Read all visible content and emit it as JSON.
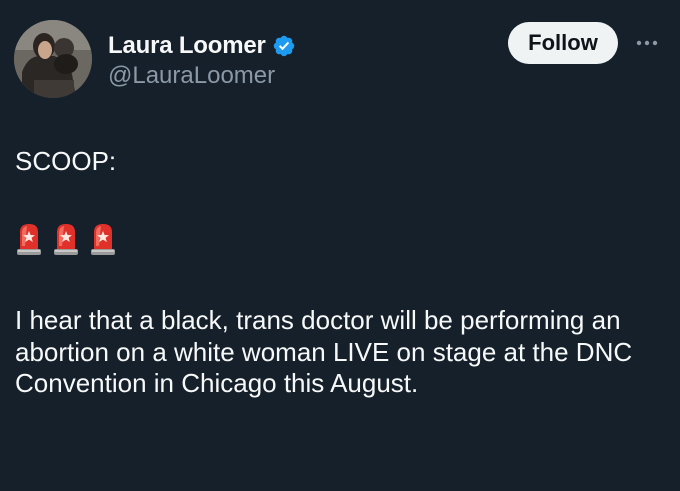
{
  "author": {
    "display_name": "Laura Loomer",
    "handle": "@LauraLoomer",
    "verified": true,
    "verified_icon": "verified-badge-icon"
  },
  "actions": {
    "follow_label": "Follow",
    "more_icon": "more-horizontal-icon"
  },
  "post": {
    "line1": "SCOOP:",
    "emoji": [
      "🚨",
      "🚨",
      "🚨"
    ],
    "body": "I hear that a black, trans doctor will be performing an abortion on a white woman LIVE on stage at the DNC Convention in Chicago this August."
  },
  "colors": {
    "background": "#15202b",
    "text_primary": "#f7f9f9",
    "text_secondary": "#8b98a5",
    "verified_blue": "#1d9bf0",
    "follow_bg": "#eff3f4",
    "follow_text": "#0f1419"
  }
}
